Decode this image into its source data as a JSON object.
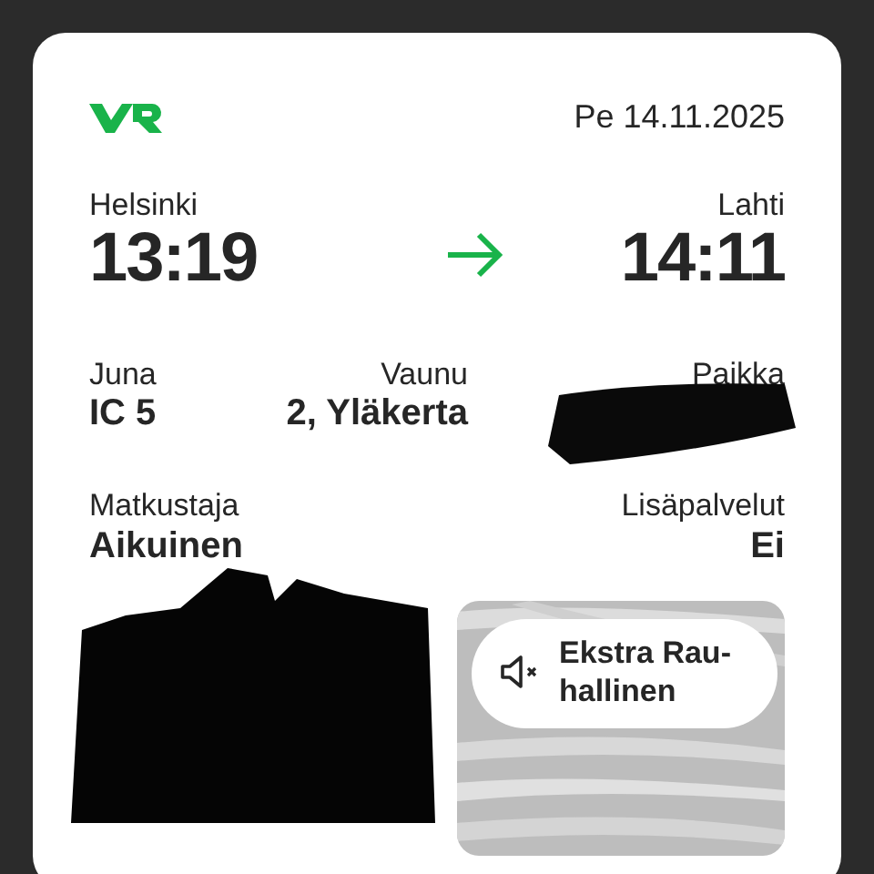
{
  "ticket": {
    "date": "Pe 14.11.2025",
    "departure": {
      "station": "Helsinki",
      "time": "13:19"
    },
    "arrival": {
      "station": "Lahti",
      "time": "14:11"
    },
    "details": [
      {
        "label": "Juna",
        "value": "IC 5",
        "redacted": false
      },
      {
        "label": "Vaunu",
        "value": "2, Yläkerta",
        "redacted": false
      },
      {
        "label": "Paikka",
        "redacted": true
      }
    ],
    "passenger": [
      {
        "label": "Matkustaja",
        "value": "Aikuinen"
      },
      {
        "label": "Lisäpalvelut",
        "value": "Ei"
      }
    ],
    "code": {
      "redacted": true
    },
    "car_class": {
      "kind": "picture",
      "label": "Ekstra Rau-hallinen"
    }
  }
}
